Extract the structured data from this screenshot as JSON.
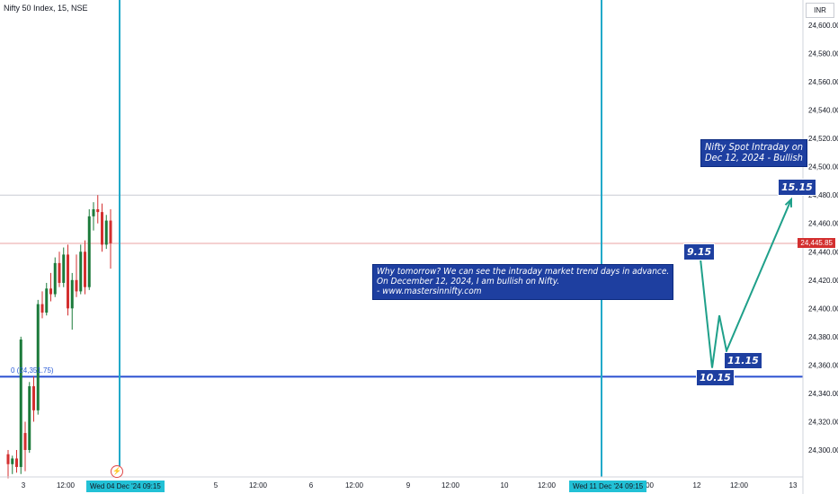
{
  "header": {
    "title": "Nifty 50 Index, 15, NSE"
  },
  "price_axis": {
    "unit": "INR",
    "ticks": [
      "24,600.00",
      "24,580.00",
      "24,560.00",
      "24,540.00",
      "24,520.00",
      "24,500.00",
      "24,480.00",
      "24,460.00",
      "24,440.00",
      "24,420.00",
      "24,400.00",
      "24,380.00",
      "24,360.00",
      "24,340.00",
      "24,320.00",
      "24,300.00"
    ],
    "last_price": "24,445.85"
  },
  "time_axis": {
    "ticks": [
      "3",
      "12:00",
      "5",
      "12:00",
      "6",
      "12:00",
      "9",
      "12:00",
      "10",
      "12:00",
      "12:00",
      "12",
      "12:00",
      "13"
    ],
    "highlighted_dates": [
      "Wed 04 Dec '24   09:15",
      "Wed 11 Dec '24   09:15"
    ]
  },
  "fib_label": "0 (24,351.75)",
  "annotations": {
    "forecast_note": "Why tomorrow? We can see the intraday market trend days in advance.\nOn December 12, 2024, I am bullish on Nifty.\n- www.mastersinnifty.com",
    "title_note": "Nifty Spot Intraday on\nDec 12, 2024 - Bullish"
  },
  "wave_labels": [
    "9.15",
    "10.15",
    "11.15",
    "15.15"
  ],
  "colors": {
    "up": "#1b7a3a",
    "down": "#d32f2f",
    "vline": "#22a9c9",
    "hline": "#2a4fd0",
    "projection": "#1fa08a",
    "label_bg": "#1e3fa0"
  },
  "icons": {
    "event": "lightning-icon"
  },
  "chart_data": {
    "type": "candlestick",
    "title": "Nifty 50 Index, 15, NSE",
    "ylim": [
      24290,
      24610
    ],
    "x_ticks": [
      "3",
      "12:00",
      "5",
      "12:00",
      "6",
      "12:00",
      "9",
      "12:00",
      "10",
      "12:00",
      "12:00",
      "12",
      "12:00",
      "13"
    ],
    "candles": [
      {
        "o": 24297,
        "h": 24300,
        "l": 24280,
        "c": 24290
      },
      {
        "o": 24290,
        "h": 24296,
        "l": 24283,
        "c": 24294
      },
      {
        "o": 24294,
        "h": 24300,
        "l": 24284,
        "c": 24288
      },
      {
        "o": 24288,
        "h": 24380,
        "l": 24283,
        "c": 24378
      },
      {
        "o": 24312,
        "h": 24320,
        "l": 24285,
        "c": 24300
      },
      {
        "o": 24300,
        "h": 24348,
        "l": 24298,
        "c": 24345
      },
      {
        "o": 24345,
        "h": 24352,
        "l": 24320,
        "c": 24328
      },
      {
        "o": 24328,
        "h": 24406,
        "l": 24325,
        "c": 24403
      },
      {
        "o": 24403,
        "h": 24412,
        "l": 24393,
        "c": 24397
      },
      {
        "o": 24397,
        "h": 24418,
        "l": 24395,
        "c": 24414
      },
      {
        "o": 24414,
        "h": 24425,
        "l": 24405,
        "c": 24410
      },
      {
        "o": 24410,
        "h": 24436,
        "l": 24408,
        "c": 24432
      },
      {
        "o": 24432,
        "h": 24440,
        "l": 24415,
        "c": 24418
      },
      {
        "o": 24418,
        "h": 24443,
        "l": 24415,
        "c": 24438
      },
      {
        "o": 24438,
        "h": 24445,
        "l": 24395,
        "c": 24400
      },
      {
        "o": 24400,
        "h": 24425,
        "l": 24385,
        "c": 24420
      },
      {
        "o": 24420,
        "h": 24438,
        "l": 24408,
        "c": 24412
      },
      {
        "o": 24412,
        "h": 24445,
        "l": 24410,
        "c": 24440
      },
      {
        "o": 24440,
        "h": 24448,
        "l": 24410,
        "c": 24415
      },
      {
        "o": 24415,
        "h": 24470,
        "l": 24413,
        "c": 24465
      },
      {
        "o": 24465,
        "h": 24475,
        "l": 24455,
        "c": 24470
      },
      {
        "o": 24470,
        "h": 24480,
        "l": 24460,
        "c": 24468
      },
      {
        "o": 24468,
        "h": 24474,
        "l": 24440,
        "c": 24445
      },
      {
        "o": 24445,
        "h": 24466,
        "l": 24442,
        "c": 24462
      },
      {
        "o": 24462,
        "h": 24470,
        "l": 24428,
        "c": 24446
      }
    ],
    "hlines": [
      24480,
      24445.85,
      24351.75
    ],
    "projection": {
      "points": [
        [
          "9.15",
          24435
        ],
        [
          "10.15",
          24358
        ],
        [
          "10.45",
          24395
        ],
        [
          "11.15",
          24370
        ],
        [
          "15.15",
          24477
        ]
      ]
    }
  }
}
